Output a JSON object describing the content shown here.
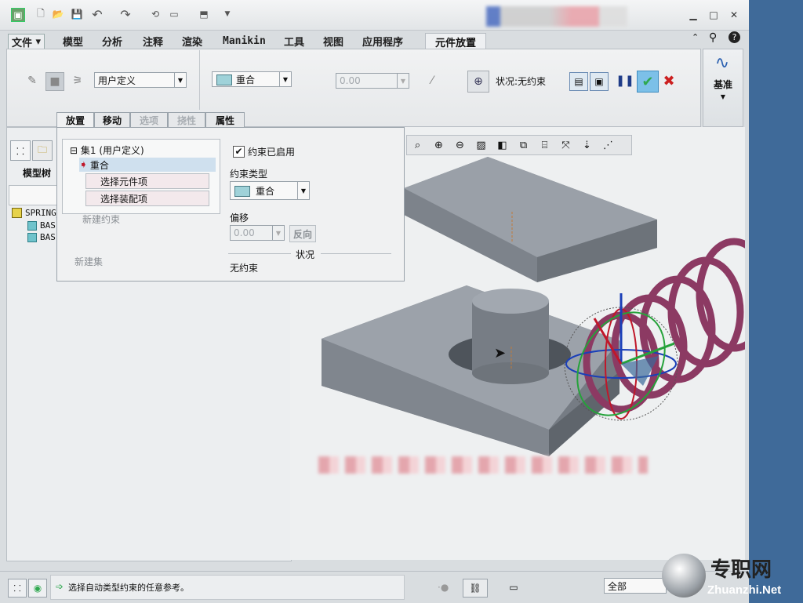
{
  "menu": {
    "file": "文件",
    "items": [
      "模型",
      "分析",
      "注释",
      "渲染",
      "Manikin",
      "工具",
      "视图",
      "应用程序"
    ],
    "active_tab": "元件放置"
  },
  "ribbon": {
    "constraint_set_type": "用户定义",
    "constraint_type": "重合",
    "offset_value": "0.00",
    "status_text": "状况:无约束",
    "datum_label": "基准",
    "subtabs": [
      {
        "label": "放置",
        "enabled": true,
        "active": true
      },
      {
        "label": "移动",
        "enabled": true,
        "active": false
      },
      {
        "label": "选项",
        "enabled": false,
        "active": false
      },
      {
        "label": "挠性",
        "enabled": false,
        "active": false
      },
      {
        "label": "属性",
        "enabled": true,
        "active": false
      }
    ]
  },
  "placement_panel": {
    "set_label": "集1 (用户定义)",
    "constraint_item": "重合",
    "select_component": "选择元件项",
    "select_assembly": "选择装配项",
    "new_constraint": "新建约束",
    "new_set": "新建集",
    "enabled_checkbox": "约束已启用",
    "enabled_checked": true,
    "constraint_type_label": "约束类型",
    "constraint_type_value": "重合",
    "offset_label": "偏移",
    "offset_value": "0.00",
    "flip_button": "反向",
    "status_label": "状况",
    "status_value": "无约束"
  },
  "model_tree": {
    "label": "模型树",
    "root": "SPRING_",
    "children": [
      "BAS",
      "BAS"
    ]
  },
  "statusbar": {
    "message": "选择自动类型约束的任意参考。",
    "filter": "全部"
  },
  "watermark": {
    "text": "专职网",
    "url": "Zhuanzhi.Net"
  },
  "colors": {
    "accent_green": "#2fa84f",
    "cancel_red": "#cc1f1f",
    "spring": "#8c3a63",
    "part": "#7f858c",
    "selection_highlight": "#cfe0ee"
  }
}
